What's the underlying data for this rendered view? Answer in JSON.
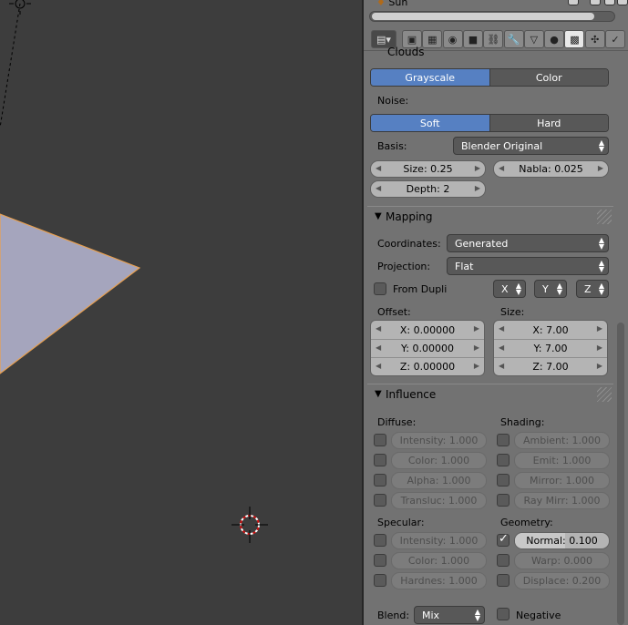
{
  "header": {
    "object_name": "Sun"
  },
  "tabs": [
    {
      "name": "render-tab",
      "glyph": "▣"
    },
    {
      "name": "render-layers-tab",
      "glyph": "▦"
    },
    {
      "name": "world-tab",
      "glyph": "◉"
    },
    {
      "name": "object-tab",
      "glyph": "■"
    },
    {
      "name": "constraints-tab",
      "glyph": "⛓"
    },
    {
      "name": "modifiers-tab",
      "glyph": "🔧"
    },
    {
      "name": "data-tab",
      "glyph": "▽"
    },
    {
      "name": "material-tab",
      "glyph": "●"
    },
    {
      "name": "texture-tab",
      "glyph": "▩"
    },
    {
      "name": "particles-tab",
      "glyph": "✣"
    },
    {
      "name": "physics-tab",
      "glyph": "✓"
    }
  ],
  "clouds": {
    "title": "Clouds",
    "color_mode": {
      "options": [
        "Grayscale",
        "Color"
      ],
      "selected": "Grayscale"
    },
    "noise_label": "Noise:",
    "noise_type": {
      "options": [
        "Soft",
        "Hard"
      ],
      "selected": "Soft"
    },
    "basis_label": "Basis:",
    "basis_value": "Blender Original",
    "size": "Size: 0.25",
    "nabla": "Nabla: 0.025",
    "depth": "Depth: 2"
  },
  "mapping": {
    "title": "Mapping",
    "coordinates_label": "Coordinates:",
    "coordinates_value": "Generated",
    "projection_label": "Projection:",
    "projection_value": "Flat",
    "from_dupli_label": "From Dupli",
    "from_dupli_checked": false,
    "axis_x": "X",
    "axis_y": "Y",
    "axis_z": "Z",
    "offset_label": "Offset:",
    "offset": [
      "X: 0.00000",
      "Y: 0.00000",
      "Z: 0.00000"
    ],
    "size_label": "Size:",
    "size": [
      "X: 7.00",
      "Y: 7.00",
      "Z: 7.00"
    ]
  },
  "influence": {
    "title": "Influence",
    "diffuse_label": "Diffuse:",
    "diffuse": [
      {
        "text": "Intensity: 1.000",
        "checked": false
      },
      {
        "text": "Color: 1.000",
        "checked": false
      },
      {
        "text": "Alpha: 1.000",
        "checked": false
      },
      {
        "text": "Transluc: 1.000",
        "checked": false
      }
    ],
    "shading_label": "Shading:",
    "shading": [
      {
        "text": "Ambient: 1.000",
        "checked": false
      },
      {
        "text": "Emit: 1.000",
        "checked": false
      },
      {
        "text": "Mirror: 1.000",
        "checked": false
      },
      {
        "text": "Ray Mirr: 1.000",
        "checked": false
      }
    ],
    "specular_label": "Specular:",
    "specular": [
      {
        "text": "Intensity: 1.000",
        "checked": false
      },
      {
        "text": "Color: 1.000",
        "checked": false
      },
      {
        "text": "Hardnes: 1.000",
        "checked": false
      }
    ],
    "geometry_label": "Geometry:",
    "geometry": [
      {
        "text": "Normal: 0.100",
        "checked": true,
        "fill": 0.1
      },
      {
        "text": "Warp: 0.000",
        "checked": false
      },
      {
        "text": "Displace: 0.200",
        "checked": false
      }
    ],
    "blend_label": "Blend:",
    "blend_value": "Mix",
    "negative_label": "Negative",
    "negative_checked": false
  },
  "colors": {
    "viewport_bg": "#3d3d3d",
    "plane_fill": "#a5a5bd",
    "plane_edge": "#e8a050",
    "toggle_active": "#5680c2",
    "panel_bg": "#727272"
  }
}
